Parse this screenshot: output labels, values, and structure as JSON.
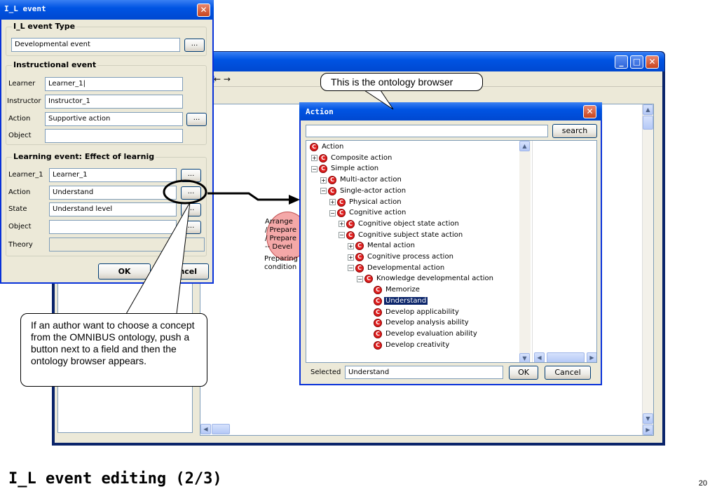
{
  "il_dialog": {
    "title": "I_L event",
    "event_type_group": "I_L event Type",
    "event_type_value": "Developmental event",
    "instructional_group": "Instructional event",
    "fields": [
      {
        "label": "Learner",
        "value": "Learner_1|"
      },
      {
        "label": "Instructor",
        "value": "Instructor_1"
      },
      {
        "label": "Action",
        "value": "Supportive action"
      },
      {
        "label": "Object",
        "value": ""
      }
    ],
    "learning_group": "Learning event: Effect of learnig",
    "learning_fields": [
      {
        "label": "Learner_1",
        "value": "Learner_1"
      },
      {
        "label": "Action",
        "value": "Understand"
      },
      {
        "label": "State",
        "value": "Understand level"
      },
      {
        "label": "Object",
        "value": ""
      },
      {
        "label": "Theory",
        "value": ""
      }
    ],
    "dots": "...",
    "ok": "OK",
    "cancel": "Cancel"
  },
  "back_window": {
    "arrows": "← →",
    "node_text": [
      "Arrange",
      "/ Prepare",
      "/ Prepare",
      "-- Devel"
    ],
    "node_sub": [
      "Preparing",
      "condition"
    ]
  },
  "ontology_browser": {
    "title": "Action",
    "search_label": "search",
    "tree": [
      {
        "label": "Action",
        "level": 0,
        "expander": ""
      },
      {
        "label": "Composite action",
        "level": 1,
        "expander": "+"
      },
      {
        "label": "Simple action",
        "level": 1,
        "expander": "−"
      },
      {
        "label": "Multi-actor action",
        "level": 2,
        "expander": "+"
      },
      {
        "label": "Single-actor action",
        "level": 2,
        "expander": "−"
      },
      {
        "label": "Physical action",
        "level": 3,
        "expander": "+"
      },
      {
        "label": "Cognitive action",
        "level": 3,
        "expander": "−"
      },
      {
        "label": "Cognitive object state action",
        "level": 4,
        "expander": "+"
      },
      {
        "label": "Cognitive subject state action",
        "level": 4,
        "expander": "−"
      },
      {
        "label": "Mental action",
        "level": 5,
        "expander": "+"
      },
      {
        "label": "Cognitive process action",
        "level": 5,
        "expander": "+"
      },
      {
        "label": "Developmental action",
        "level": 5,
        "expander": "−"
      },
      {
        "label": "Knowledge developmental action",
        "level": 6,
        "expander": "−"
      },
      {
        "label": "Memorize",
        "level": 7,
        "expander": ""
      },
      {
        "label": "Understand",
        "level": 7,
        "expander": "",
        "selected": true
      },
      {
        "label": "Develop applicability",
        "level": 7,
        "expander": ""
      },
      {
        "label": "Develop analysis ability",
        "level": 7,
        "expander": ""
      },
      {
        "label": "Develop evaluation ability",
        "level": 7,
        "expander": ""
      },
      {
        "label": "Develop creativity",
        "level": 7,
        "expander": ""
      }
    ],
    "selected_label": "Selected",
    "selected_value": "Understand",
    "ok": "OK",
    "cancel": "Cancel"
  },
  "callouts": {
    "top": "This is the ontology browser",
    "bottom": "If an author want to choose a concept from the OMNIBUS ontology, push a button next to a field and then the ontology browser appears."
  },
  "slide": {
    "title": "I_L event editing (2/3)",
    "page": "20"
  },
  "colors": {
    "titlebar": "#0054e3",
    "selection": "#0a246a",
    "concept_icon": "#e02020",
    "node_fill": "#f4a8a8"
  }
}
